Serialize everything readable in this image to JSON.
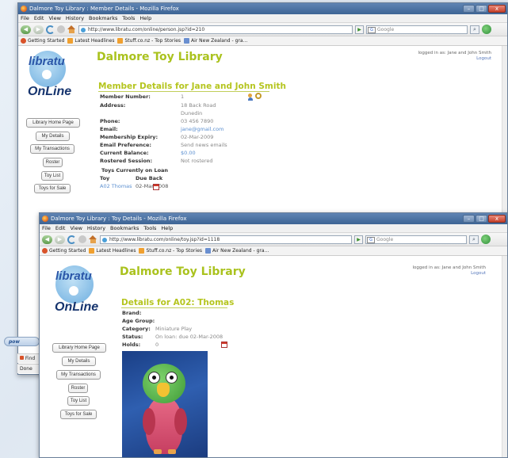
{
  "window1": {
    "title": "Dalmore Toy Library : Member Details - Mozilla Firefox",
    "url": "http://www.libratu.com/online/person.jsp?id=210"
  },
  "window2": {
    "title": "Dalmore Toy Library : Toy Details - Mozilla Firefox",
    "url": "http://www.libratu.com/online/toy.jsp?id=1118"
  },
  "browser": {
    "menu": [
      "File",
      "Edit",
      "View",
      "History",
      "Bookmarks",
      "Tools",
      "Help"
    ],
    "search_placeholder": "Google",
    "bookmarks": [
      "Getting Started",
      "Latest Headlines",
      "Stuff.co.nz - Top Stories",
      "Air New Zealand - gra..."
    ],
    "status_done": "Done",
    "find_label": "Find",
    "bg_tab_fragment": "pow"
  },
  "site": {
    "title": "Dalmore Toy Library",
    "logo_line1": "libratu",
    "logo_line2": "OnLine",
    "logged_in": "logged in as: Jane and John Smith",
    "logout": "Logout",
    "nav": [
      "Library Home Page",
      "My Details",
      "My Transactions",
      "Roster",
      "Toy List",
      "Toys for Sale"
    ]
  },
  "member": {
    "heading": "Member Details for Jane and John Smith",
    "fields": [
      {
        "label": "Member Number:",
        "value": "1"
      },
      {
        "label": "Address:",
        "value": "18 Back Road"
      },
      {
        "label": "",
        "value": "Dunedin"
      },
      {
        "label": "Phone:",
        "value": "03 456 7890"
      },
      {
        "label": "Email:",
        "value": "jane@gmail.com"
      },
      {
        "label": "Membership Expiry:",
        "value": "02-Mar-2009"
      },
      {
        "label": "Email Preference:",
        "value": "Send news emails"
      },
      {
        "label": "Current Balance:",
        "value": "$0.00"
      },
      {
        "label": "Rostered Session:",
        "value": "Not rostered"
      }
    ],
    "loans_heading": "Toys Currently on Loan",
    "loans_col_toy": "Toy",
    "loans_col_due": "Due Back",
    "loans": [
      {
        "toy": "A02 Thomas",
        "due": "02-Mar-2008"
      }
    ]
  },
  "toy": {
    "heading": "Details for A02: Thomas",
    "fields": [
      {
        "label": "Brand:",
        "value": ""
      },
      {
        "label": "Age Group:",
        "value": ""
      },
      {
        "label": "Category:",
        "value": "Miniature Play"
      },
      {
        "label": "Status:",
        "value": "On loan: due 02-Mar-2008"
      },
      {
        "label": "Holds:",
        "value": "0"
      }
    ]
  }
}
